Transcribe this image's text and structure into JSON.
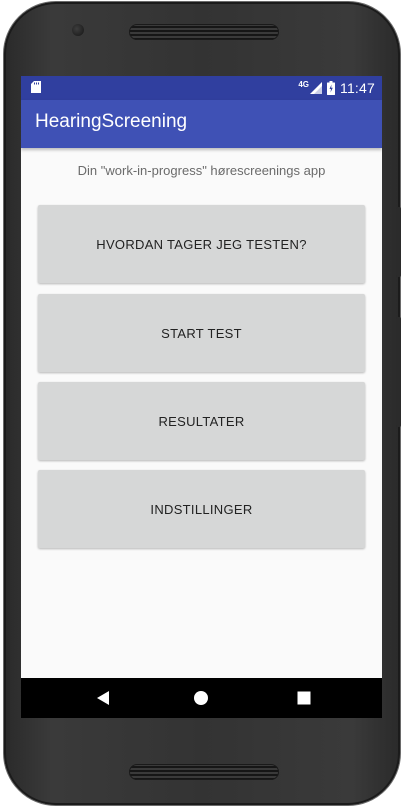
{
  "status_bar": {
    "network": "4G",
    "time": "11:47"
  },
  "app_bar": {
    "title": "HearingScreening"
  },
  "main": {
    "subtitle": "Din \"work-in-progress\" hørescreenings app",
    "buttons": [
      {
        "label": "HVORDAN TAGER JEG TESTEN?"
      },
      {
        "label": "START TEST"
      },
      {
        "label": "RESULTATER"
      },
      {
        "label": "INDSTILLINGER"
      }
    ]
  },
  "nav_bar": {
    "icons": [
      "back-icon",
      "home-icon",
      "recents-icon"
    ]
  },
  "colors": {
    "status_bar": "#303f9f",
    "app_bar": "#3f51b5",
    "button_bg": "#d6d7d7",
    "screen_bg": "#fafafa"
  }
}
